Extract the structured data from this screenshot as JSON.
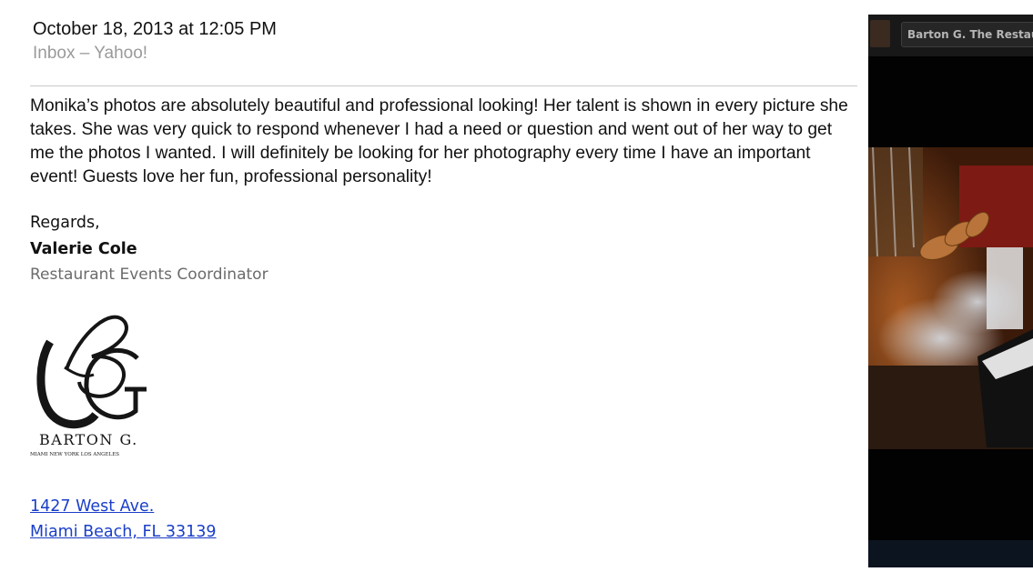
{
  "header": {
    "date": "October 18, 2013 at 12:05 PM",
    "folder": "Inbox – Yahoo!"
  },
  "message": {
    "body": "Monika’s photos are absolutely beautiful and professional looking!  Her talent is shown in every picture she takes.  She was very quick to respond whenever I had a need or question and went out of her way to get me the photos I wanted.  I will definitely be looking for her photography every time I have an important event!  Guests love her fun, professional personality!"
  },
  "signature": {
    "greeting": "Regards,",
    "name": "Valerie Cole",
    "title": "Restaurant Events Coordinator",
    "logo": {
      "brand": "BARTON G.",
      "cities": "MIAMI   NEW YORK   LOS ANGELES"
    },
    "address_line1": "1427 West Ave.",
    "address_line2": "Miami Beach, FL 33139"
  },
  "side_panel": {
    "tab_title": "Barton G. The Restaurant",
    "photo_icon": "food-photo"
  },
  "colors": {
    "link": "#1a3ec8",
    "muted": "#9a9a9a",
    "panel_bg": "#020202"
  }
}
